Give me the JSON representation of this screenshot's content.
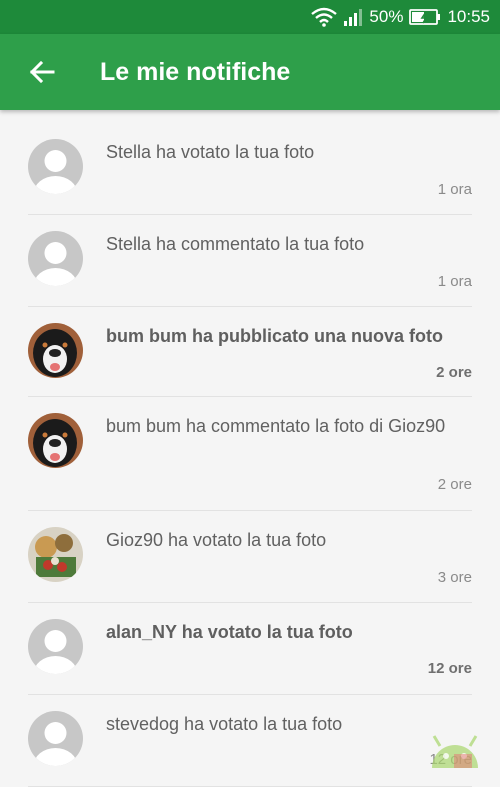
{
  "status_bar": {
    "battery_percent": "50%",
    "time": "10:55",
    "icons": [
      "wifi-icon",
      "signal-icon",
      "battery-icon"
    ]
  },
  "app_bar": {
    "back_icon": "arrow-back-icon",
    "title": "Le mie notifiche"
  },
  "colors": {
    "status_bar": "#1e8a3a",
    "app_bar": "#2e9f4a",
    "background": "#f5f5f5"
  },
  "notifications": [
    {
      "avatar": "default-avatar",
      "text": "Stella ha votato la tua foto",
      "time": "1 ora",
      "unread": false
    },
    {
      "avatar": "default-avatar",
      "text": "Stella ha commentato la tua foto",
      "time": "1 ora",
      "unread": false
    },
    {
      "avatar": "dog-avatar",
      "text": "bum bum ha pubblicato una nuova foto",
      "time": "2 ore",
      "unread": true
    },
    {
      "avatar": "dog-avatar",
      "text": "bum bum ha commentato la foto di Gioz90",
      "time": "2 ore",
      "unread": false
    },
    {
      "avatar": "photo-avatar",
      "text": "Gioz90 ha votato la tua foto",
      "time": "3 ore",
      "unread": false
    },
    {
      "avatar": "default-avatar",
      "text": "alan_NY ha votato la tua foto",
      "time": "12 ore",
      "unread": true
    },
    {
      "avatar": "default-avatar",
      "text": "stevedog ha votato la tua foto",
      "time": "12 ore",
      "unread": false
    }
  ]
}
